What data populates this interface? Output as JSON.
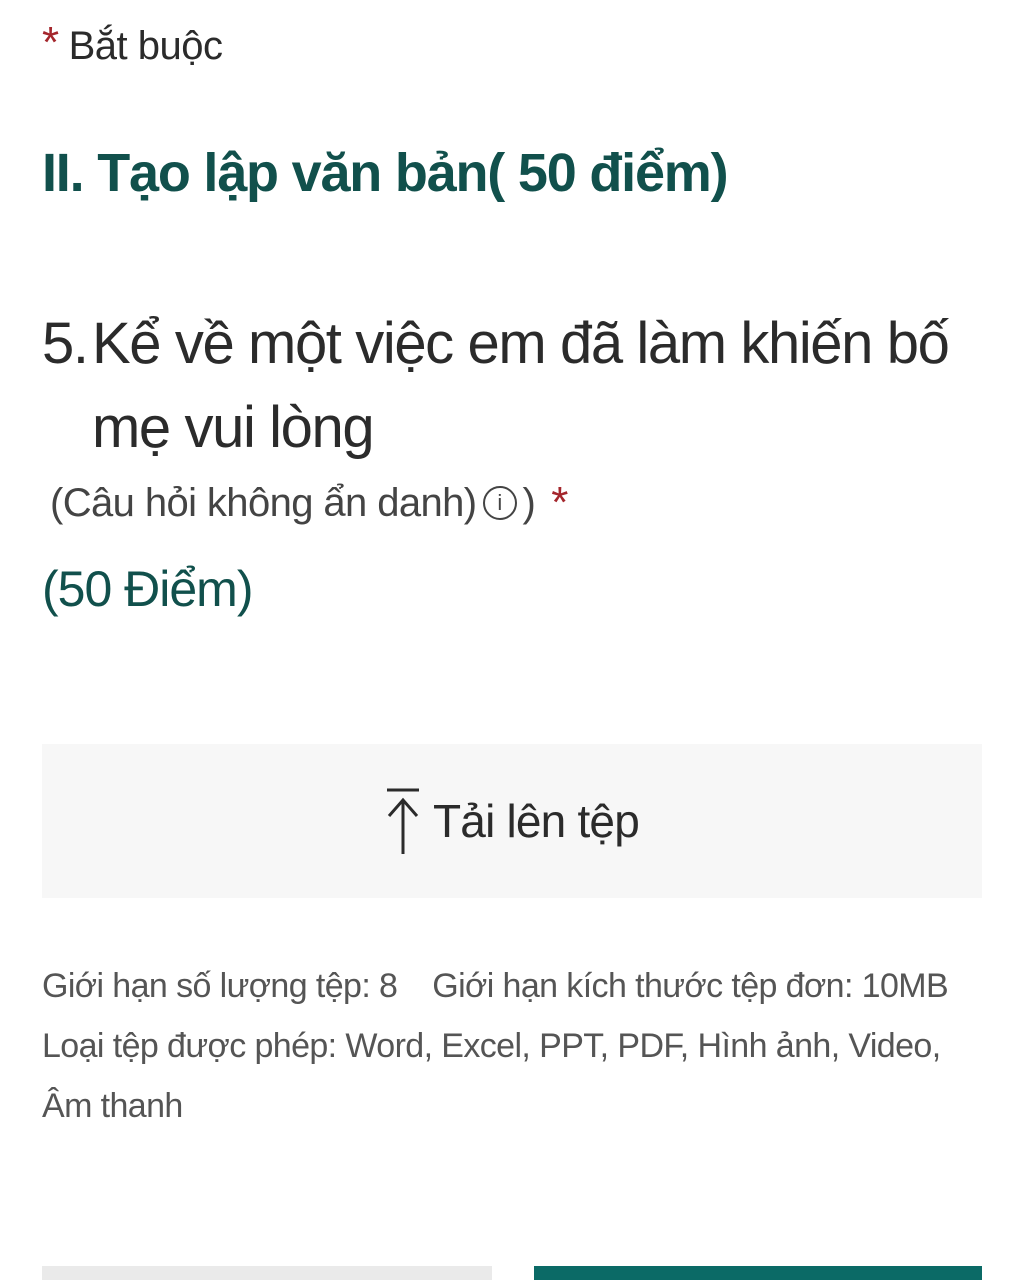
{
  "required_note": {
    "star": "*",
    "label": "Bắt buộc"
  },
  "section": {
    "title": "II. Tạo lập văn bản( 50 điểm)"
  },
  "question": {
    "number": "5.",
    "text": "Kể  về một việc em đã làm khiến bố mẹ vui lòng",
    "meta_prefix": "(Câu hỏi không ẩn danh)",
    "info_icon": "info-circle-icon",
    "meta_suffix": ")",
    "required_star": "*",
    "points": "(50 Điểm)"
  },
  "upload": {
    "icon": "upload-arrow-icon",
    "label": "Tải lên tệp"
  },
  "limits": {
    "count": "Giới hạn số lượng tệp: 8",
    "size": "Giới hạn kích thước tệp đơn: 10MB",
    "types": "Loại tệp được phép: Word, Excel, PPT, PDF, Hình ảnh, Video, Âm thanh"
  },
  "colors": {
    "accent": "#11504c",
    "required": "#a4262c",
    "upload_bg": "#f7f7f7",
    "primary_button": "#0b6a66"
  }
}
